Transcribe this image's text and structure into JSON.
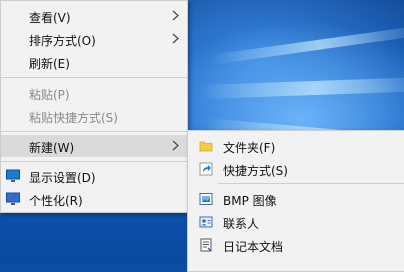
{
  "context_menu": {
    "items": [
      {
        "label": "查看(V)"
      },
      {
        "label": "排序方式(O)"
      },
      {
        "label": "刷新(E)"
      },
      {
        "label": "粘贴(P)"
      },
      {
        "label": "粘贴快捷方式(S)"
      },
      {
        "label": "新建(W)"
      },
      {
        "label": "显示设置(D)"
      },
      {
        "label": "个性化(R)"
      }
    ]
  },
  "new_submenu": {
    "items": [
      {
        "label": "文件夹(F)"
      },
      {
        "label": "快捷方式(S)"
      },
      {
        "label": "BMP 图像"
      },
      {
        "label": "联系人"
      },
      {
        "label": "日记本文档"
      }
    ]
  },
  "colors": {
    "menu_bg": "#f2f2f2",
    "highlight": "#dadada",
    "disabled_text": "#8a8a8a",
    "desktop_blue": "#0e5bbf"
  }
}
